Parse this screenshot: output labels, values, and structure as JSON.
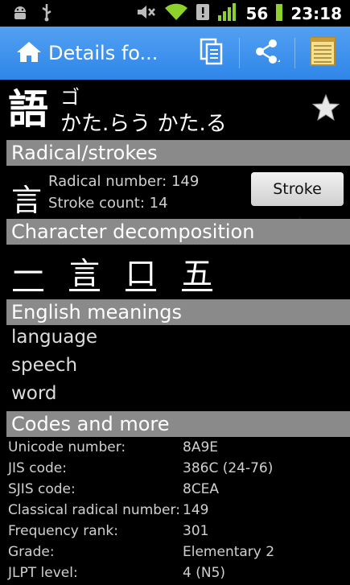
{
  "status_bar": {
    "signal_strength": "56",
    "time": "23:18"
  },
  "action_bar": {
    "title": "Details fo..."
  },
  "kanji": {
    "character": "語",
    "on_reading": "ゴ",
    "kun_reading": "かた.らう かた.る"
  },
  "sections": {
    "radical_strokes": "Radical/strokes",
    "decomposition": "Character decomposition",
    "meanings": "English meanings",
    "codes": "Codes and more"
  },
  "radical": {
    "glyph": "言",
    "number_label": "Radical number:",
    "number_value": "149",
    "stroke_label": "Stroke count:",
    "stroke_value": "14",
    "stroke_order_button": "Stroke order"
  },
  "decomposition": [
    "一",
    "言",
    "口",
    "五"
  ],
  "meanings": [
    "language",
    "speech",
    "word"
  ],
  "codes": [
    {
      "label": "Unicode number:",
      "value": "8A9E"
    },
    {
      "label": "JIS code:",
      "value": "386C (24-76)"
    },
    {
      "label": "SJIS code:",
      "value": "8CEA"
    },
    {
      "label": "Classical radical number:",
      "value": "149"
    },
    {
      "label": "Frequency rank:",
      "value": "301"
    },
    {
      "label": "Grade:",
      "value": "Elementary 2"
    },
    {
      "label": "JLPT level:",
      "value": "4 (N5)"
    }
  ],
  "colors": {
    "action_bar": "#3b8fee",
    "section_header": "#8a8a8a",
    "signal_green": "#8ed12a"
  }
}
